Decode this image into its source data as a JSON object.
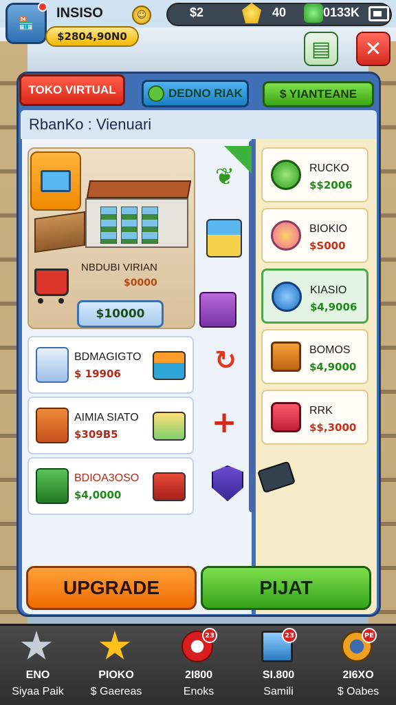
{
  "hud": {
    "player_name": "INSISO",
    "cash": "$2804,90N0",
    "stat_a": "$2",
    "stat_b": "40",
    "stat_c": "0133K"
  },
  "tabs": {
    "main": "TOKO VIRTUAL",
    "second": "DEDNO RIAK",
    "third": "$ YIANTEANE"
  },
  "subtitle": "RbanKo : Vienuari",
  "store": {
    "name": "NBDUBI VIRIAN",
    "price": "$0000",
    "pill_price": "$10000"
  },
  "left_items": [
    {
      "name": "BDMAGIGTO",
      "price": "$ 19906",
      "price_color": "#b42a1a"
    },
    {
      "name": "AIMIA SIATO",
      "price": "$309B5",
      "price_color": "#b42a1a"
    },
    {
      "name": "BDIOA3OSO",
      "price": "$4,0000",
      "price_color": "#1f8a1a"
    }
  ],
  "right_items": [
    {
      "name": "RUCKO",
      "price": "$$2006",
      "price_color": "#1f8a1a",
      "selected": false
    },
    {
      "name": "BIOKIO",
      "price": "$S000",
      "price_color": "#c8301a",
      "selected": false
    },
    {
      "name": "KIASIO",
      "price": "$4,9006",
      "price_color": "#1f8a1a",
      "selected": true
    },
    {
      "name": "BOMOS",
      "price": "$4,9000",
      "price_color": "#1f8a1a",
      "selected": false
    },
    {
      "name": "RRK",
      "price": "$$,3000",
      "price_color": "#c8301a",
      "selected": false
    }
  ],
  "buttons": {
    "upgrade": "UPGRADE",
    "buy": "PIJAT"
  },
  "nav": [
    {
      "l1": "ENO",
      "l2": "Siyaa Paik",
      "badge": ""
    },
    {
      "l1": "PIOKO",
      "l2": "$ Gaereas",
      "badge": ""
    },
    {
      "l1": "2I800",
      "l2": "Enoks",
      "badge": "23"
    },
    {
      "l1": "SI.800",
      "l2": "Samili",
      "badge": "23"
    },
    {
      "l1": "2I6XO",
      "l2": "$ Oabes",
      "badge": "PE"
    }
  ],
  "icons": {
    "avatar": "shop-register-icon",
    "menu": "menu-icon",
    "close": "close-icon"
  }
}
